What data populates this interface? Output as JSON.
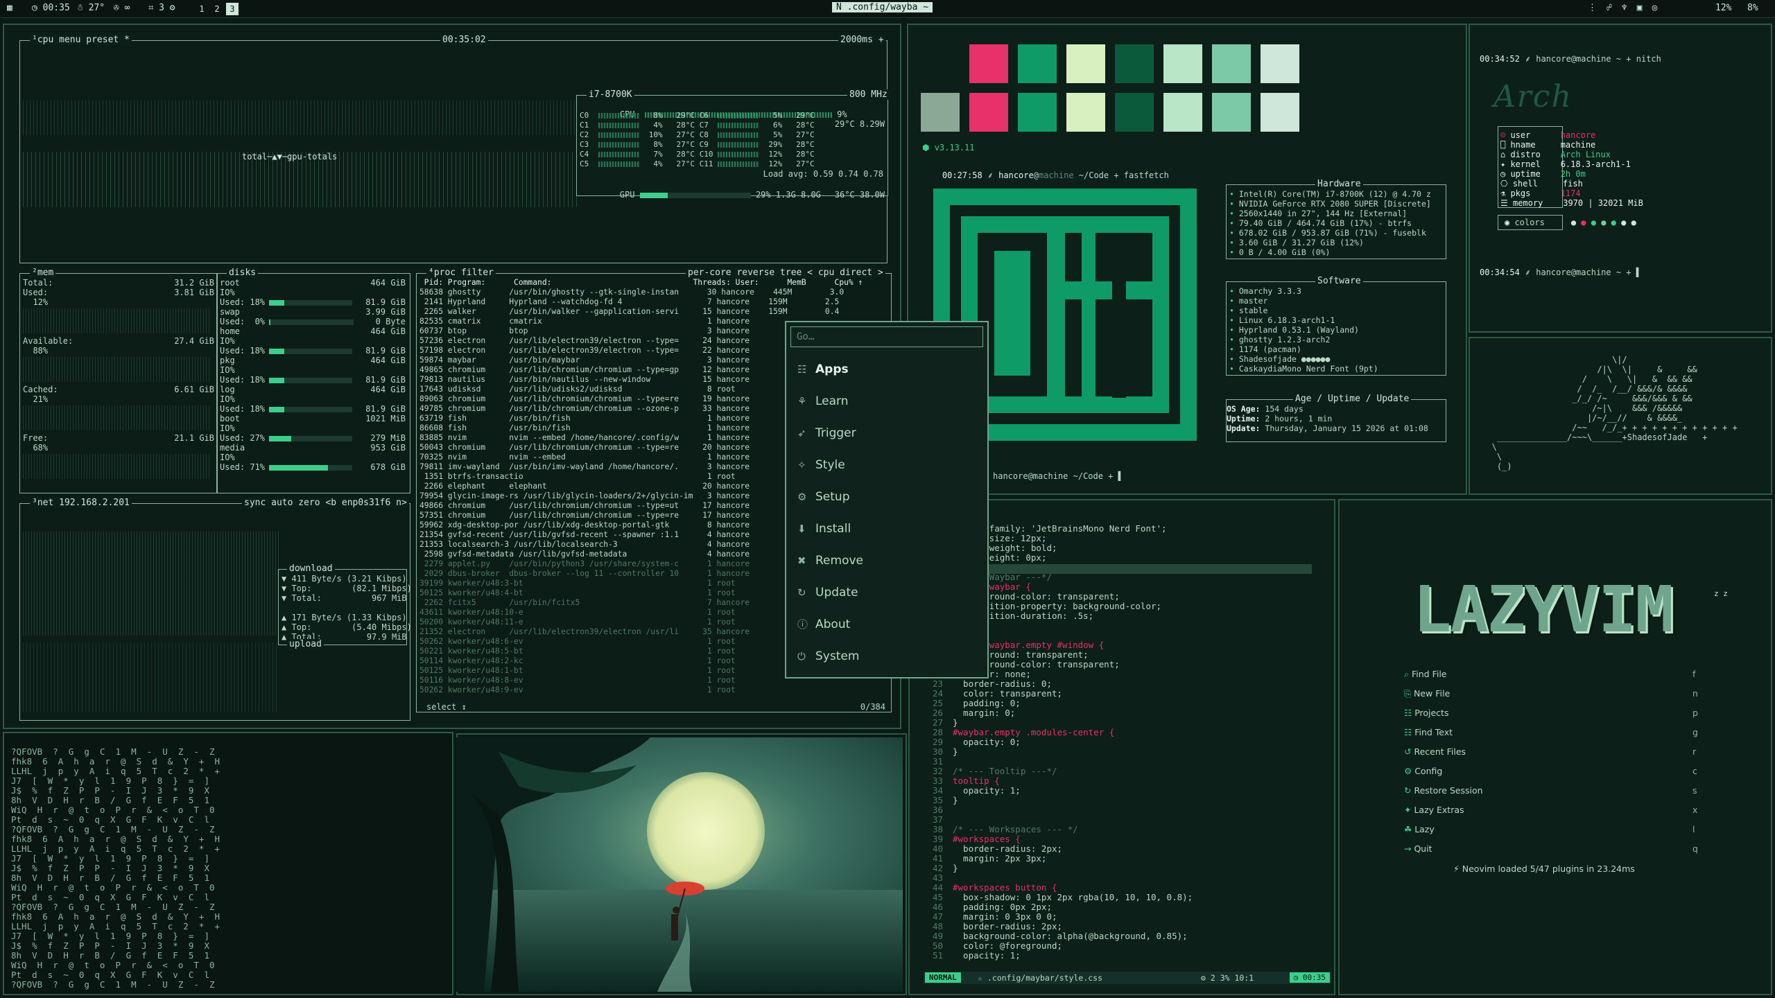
{
  "topbar": {
    "clock": "◷ 00:35",
    "weather": "☃ 27°",
    "indicators": "✇ ∞",
    "icons2": "⌗ 3 ⚙",
    "workspaces": [
      "1",
      "2",
      "3"
    ],
    "title": "N  .config/wayba ~",
    "right_battery": "12%",
    "right_vol": "8%"
  },
  "btop": {
    "cpu_header": "¹cpu menu preset *",
    "cpu_time": "00:35:02",
    "cpu_rate": "2000ms +",
    "total_label": "total─▲▼─gpu-totals",
    "cpu_model": "i7-8700K",
    "cpu_mhz": "800 MHz",
    "cpu_line": "CPU  ",
    "cpu_pct": "9%",
    "cpu_temp": "29°C 8.29W",
    "cores": [
      [
        "C0",
        "8%",
        "29°C",
        "C6",
        "5%",
        "29°C"
      ],
      [
        "C1",
        "4%",
        "28°C",
        "C7",
        "6%",
        "28°C"
      ],
      [
        "C2",
        "10%",
        "27°C",
        "C8",
        "5%",
        "27°C"
      ],
      [
        "C3",
        "8%",
        "27°C",
        "C9",
        "29%",
        "28°C"
      ],
      [
        "C4",
        "7%",
        "28°C",
        "C10",
        "12%",
        "28°C"
      ],
      [
        "C5",
        "4%",
        "27°C",
        "C11",
        "12%",
        "27°C"
      ]
    ],
    "load_avg": "Load avg: 0.59 0.74 0.78",
    "gpu_line": "GPU",
    "gpu_pct": "29%",
    "gpu_mem": "1.3G 8.0G",
    "gpu_temp": "36°C 38.0W",
    "mem_header": "²mem",
    "mem": [
      {
        "k": "Total:",
        "v": "31.2 GiB"
      },
      {
        "k": "Used:",
        "v": "3.81 GiB",
        "p": "12%"
      },
      {
        "k": "Available:",
        "v": "27.4 GiB",
        "p": "88%"
      },
      {
        "k": "Cached:",
        "v": "6.61 GiB",
        "p": "21%"
      },
      {
        "k": "Free:",
        "v": "21.1 GiB",
        "p": "68%"
      }
    ],
    "disks_header": "disks",
    "disks": [
      {
        "name": "root",
        "size": "464 GiB",
        "io": "IO%",
        "used": "Used: 18%",
        "uv": "81.9 GiB"
      },
      {
        "name": "swap",
        "size": "3.99 GiB",
        "io": "",
        "used": "Used:  0%",
        "uv": "0 Byte"
      },
      {
        "name": "home",
        "size": "464 GiB",
        "io": "IO%",
        "used": "Used: 18%",
        "uv": "81.9 GiB"
      },
      {
        "name": "pkg",
        "size": "464 GiB",
        "io": "IO%",
        "used": "Used: 18%",
        "uv": "81.9 GiB"
      },
      {
        "name": "log",
        "size": "464 GiB",
        "io": "IO%",
        "used": "Used: 18%",
        "uv": "81.9 GiB"
      },
      {
        "name": "boot",
        "size": "1021 MiB",
        "io": "IO%",
        "used": "Used: 27%",
        "uv": "279 MiB"
      },
      {
        "name": "media",
        "size": "953 GiB",
        "io": "IO%",
        "used": "Used: 71%",
        "uv": "678 GiB"
      }
    ],
    "net_header": "³net 192.168.2.201",
    "net_opts": "sync auto zero <b enp0s31f6 n>",
    "download_lbl": "download",
    "dl": [
      "▼ 411 Byte/s (3.21 Kibps)",
      "▼ Top:        (82.1 Mibps)",
      "▼ Total:          967 MiB"
    ],
    "ul": [
      "▲ 171 Byte/s (1.33 Kibps)",
      "▲ Top:        (5.40 Mibps)",
      "▲ Total:         97.9 MiB"
    ],
    "upload_lbl": "upload",
    "proc_header": "⁴proc filter",
    "proc_opts": "per-core reverse tree < cpu direct >",
    "proc_cols": " Pid: Program:      Command:                              Threads: User:      MemB      Cpu% ↑",
    "procs": [
      "58638 ghostty      /usr/bin/ghostty --gtk-single-instan      30 hancore    445M        3.0",
      " 2141 Hyprland     Hyprland --watchdog-fd 4                  7 hancore    159M        2.5",
      " 2265 walker       /usr/bin/walker --gapplication-servi     15 hancore    159M        0.4",
      "82535 cmatrix      cmatrix                                   1 hancore",
      "60737 btop         btop                                      3 hancore",
      "57236 electron     /usr/lib/electron39/electron --type=     24 hancore",
      "57198 electron     /usr/lib/electron39/electron --type=     22 hancore",
      "59874 maybar       /usr/bin/maybar                           3 hancore",
      "49865 chromium     /usr/lib/chromium/chromium --type=gp     12 hancore",
      "79813 nautilus     /usr/bin/nautilus --new-window           15 hancore",
      "17643 udisksd      /usr/lib/udisks2/udisksd                  8 root",
      "89063 chromium     /usr/lib/chromium/chromium --type=re     19 hancore",
      "49785 chromium     /usr/lib/chromium/chromium --ozone-p     33 hancore",
      "63719 fish         /usr/bin/fish                             1 hancore",
      "86608 fish         /usr/bin/fish                             1 hancore",
      "83885 nvim         nvim --embed /home/hancore/.config/w      1 hancore",
      "50043 chromium     /usr/lib/chromium/chromium --type=re     20 hancore",
      "70325 nvim         nvim --embed                              1 hancore",
      "79811 imv-wayland  /usr/bin/imv-wayland /home/hancore/.      3 hancore",
      " 1351 btrfs-transactio                                       1 root",
      " 2266 elephant     elephant                                 20 hancore",
      "79954 glycin-image-rs /usr/lib/glycin-loaders/2+/glycin-im   3 hancore",
      "49866 chromium     /usr/lib/chromium/chromium --type=ut     17 hancore",
      "57351 chromium     /usr/lib/chromium/chromium --type=re     17 hancore",
      "59962 xdg-desktop-por /usr/lib/xdg-desktop-portal-gtk        8 hancore",
      "21354 gvfsd-recent /usr/lib/gvfsd-recent --spawner :1.1      4 hancore",
      "21353 localsearch-3 /usr/lib/localsearch-3                   4 hancore",
      " 2598 gvfsd-metadata /usr/lib/gvfsd-metadata                 4 hancore",
      " 2279 applet.py    /usr/bin/python3 /usr/share/system-c      1 hancore",
      " 2029 dbus-broker  dbus-broker --log 11 --controller 10      1 hancore",
      "39199 kworker/u48:3-bt                                       1 root",
      "50125 kworker/u48:4-bt                                       1 root",
      " 2262 fcitx5       /usr/bin/fcitx5                           7 hancore",
      "43611 kworker/u48:10-e                                       1 root",
      "50200 kworker/u48:11-e                                       1 root",
      "21352 electron     /usr/lib/electron39/electron /usr/li     35 hancore",
      "50262 kworker/u48:6-ev                                       1 root",
      "50221 kworker/u48:5-bt                                       1 root",
      "50114 kworker/u48:2-kc                                       1 root",
      "50125 kworker/u48:1-bt                                       1 root",
      "50116 kworker/u48:8-ev                                       1 root",
      "50262 kworker/u48:9-ev                                       1 root"
    ],
    "proc_footer": "select ↕",
    "proc_count": "0/384"
  },
  "launcher": {
    "placeholder": "Go…",
    "items": [
      {
        "icon": "☷",
        "label": "Apps"
      },
      {
        "icon": "⚘",
        "label": "Learn"
      },
      {
        "icon": "➶",
        "label": "Trigger"
      },
      {
        "icon": "✧",
        "label": "Style"
      },
      {
        "icon": "⚙",
        "label": "Setup"
      },
      {
        "icon": "⬇",
        "label": "Install"
      },
      {
        "icon": "✖",
        "label": "Remove"
      },
      {
        "icon": "↻",
        "label": "Update"
      },
      {
        "icon": "ⓘ",
        "label": "About"
      },
      {
        "icon": "⏻",
        "label": "System"
      }
    ]
  },
  "fastfetch": {
    "version": "⬢ v3.13.11",
    "prompt_time": "00:27:58",
    "prompt_user": "hancore",
    "prompt_host": "machine",
    "prompt_cmd": "~/Code + fastfetch",
    "hardware_title": "Hardware",
    "hardware": [
      "Intel(R) Core(TM) i7-8700K (12) @ 4.70 z",
      "NVIDIA GeForce RTX 2080 SUPER [Discrete]",
      "2560x1440 in 27\", 144 Hz [External]",
      "79.40 GiB / 464.74 GiB (17%) - btrfs",
      "678.02 GiB / 953.87 GiB (71%) - fuseblk",
      "3.60 GiB / 31.27 GiB (12%)",
      "0 B / 4.00 GiB (0%)"
    ],
    "software_title": "Software",
    "software": [
      "Omarchy 3.3.3",
      "master",
      "stable",
      "Linux 6.18.3-arch1-1",
      "Hyprland 0.53.1 (Wayland)",
      "ghostty 1.2.3-arch2",
      "1174 (pacman)",
      "Shadesofjade ●●●●●●",
      "CaskaydiaMono Nerd Font (9pt)"
    ],
    "age_title": "Age / Uptime / Update",
    "age": [
      {
        "k": "OS Age:",
        "v": "154 days"
      },
      {
        "k": "Uptime:",
        "v": "2 hours, 1 min"
      },
      {
        "k": "Update:",
        "v": "Thursday, January 15 2026 at 01:08"
      }
    ],
    "prompt2": "hancore@machine ~/Code + ▌",
    "colors": {
      "pink": "#e8306a",
      "green": "#0f9b67",
      "lime": "#d8f0c0",
      "dark": "#0b5a3b",
      "mint": "#b9e6c6",
      "seafoam": "#7cc9a8",
      "pale": "#cfe6da",
      "gray": "#8aa894"
    }
  },
  "nitch": {
    "prompt1_time": "00:34:52",
    "prompt1": "⸙ hancore@machine ~ + nitch",
    "logo": "Arch",
    "rows": [
      {
        "k": "user",
        "v": "hancore"
      },
      {
        "k": "hname",
        "v": "machine"
      },
      {
        "k": "distro",
        "v": "Arch Linux"
      },
      {
        "k": "kernel",
        "v": "6.18.3-arch1-1"
      },
      {
        "k": "uptime",
        "v": "2h 0m"
      },
      {
        "k": "shell",
        "v": "fish"
      },
      {
        "k": "pkgs",
        "v": "1174"
      },
      {
        "k": "memory",
        "v": "3970 | 32021 MiB"
      }
    ],
    "colors_label": "colors",
    "prompt2_time": "00:34:54",
    "prompt2": "⸙ hancore@machine ~ + ▌"
  },
  "ascii_art": {
    "lines": [
      "                           \\|/",
      "                        /|\\  \\|     &     &&",
      "                     /    \\   \\|   &  && &&",
      "                    /  /_  /__/ &&&/& &&&&",
      "                   _/_/ /~     &&&/&&& & &&",
      "                       /~|\\    &&& /&&&&&",
      "                      |/~/__//    & &&&&_",
      "                   /~~   /_/_+ + + + + + + + + + + +",
      "    ______________/~~~\\______+ShadesofJade   +",
      "   \\",
      "    \\",
      "    (_)"
    ],
    "signature": "ShadesofJade"
  },
  "nvim": {
    "code": [
      {
        "n": "",
        "t": "  font-family: 'JetBrainsMono Nerd Font';"
      },
      {
        "n": "",
        "t": "  font-size: 12px;"
      },
      {
        "n": "",
        "t": "  font-weight: bold;"
      },
      {
        "n": "",
        "t": "  min-height: 0px;"
      },
      {
        "n": "",
        "t": ""
      },
      {
        "n": "",
        "t": "/* --- Waybar ---*/"
      },
      {
        "n": "",
        "t": "window#waybar {"
      },
      {
        "n": "",
        "t": "  background-color: transparent;"
      },
      {
        "n": "",
        "t": "  transition-property: background-color;"
      },
      {
        "n": "",
        "t": "  transition-duration: .5s;"
      },
      {
        "n": "",
        "t": "}"
      },
      {
        "n": "",
        "t": ""
      },
      {
        "n": "",
        "t": "window#waybar.empty #window {"
      },
      {
        "n": "",
        "t": "  background: transparent;"
      },
      {
        "n": "",
        "t": "  background-color: transparent;"
      },
      {
        "n": "22",
        "t": "  border: none;"
      },
      {
        "n": "23",
        "t": "  border-radius: 0;"
      },
      {
        "n": "24",
        "t": "  color: transparent;"
      },
      {
        "n": "25",
        "t": "  padding: 0;"
      },
      {
        "n": "26",
        "t": "  margin: 0;"
      },
      {
        "n": "27",
        "t": "}"
      },
      {
        "n": "28",
        "t": "#waybar.empty .modules-center {"
      },
      {
        "n": "29",
        "t": "  opacity: 0;"
      },
      {
        "n": "30",
        "t": "}"
      },
      {
        "n": "31",
        "t": ""
      },
      {
        "n": "32",
        "t": "/* --- Tooltip ---*/"
      },
      {
        "n": "33",
        "t": "tooltip {"
      },
      {
        "n": "34",
        "t": "  opacity: 1;"
      },
      {
        "n": "35",
        "t": "}"
      },
      {
        "n": "36",
        "t": ""
      },
      {
        "n": "37",
        "t": ""
      },
      {
        "n": "38",
        "t": "/* --- Workspaces --- */"
      },
      {
        "n": "39",
        "t": "#workspaces {"
      },
      {
        "n": "40",
        "t": "  border-radius: 2px;"
      },
      {
        "n": "41",
        "t": "  margin: 2px 3px;"
      },
      {
        "n": "42",
        "t": "}"
      },
      {
        "n": "43",
        "t": ""
      },
      {
        "n": "44",
        "t": "#workspaces button {"
      },
      {
        "n": "45",
        "t": "  box-shadow: 0 1px 2px rgba(10, 10, 10, 0.8);"
      },
      {
        "n": "46",
        "t": "  padding: 0px 2px;"
      },
      {
        "n": "47",
        "t": "  margin: 0 3px 0 0;"
      },
      {
        "n": "48",
        "t": "  border-radius: 2px;"
      },
      {
        "n": "49",
        "t": "  background-color: alpha(@background, 0.85);"
      },
      {
        "n": "50",
        "t": "  color: @foreground;"
      },
      {
        "n": "51",
        "t": "  opacity: 1;"
      }
    ],
    "mode": "NORMAL",
    "file": "☆ .config/maybar/style.css",
    "status_right": "⚙ 2   3%   10:1",
    "clock": "◷ 00:35"
  },
  "lazyvim": {
    "logo": "LAZYVIM",
    "zz": "z z",
    "items": [
      {
        "icon": "⌕",
        "label": "Find File",
        "key": "f"
      },
      {
        "icon": "⎘",
        "label": "New File",
        "key": "n"
      },
      {
        "icon": "☷",
        "label": "Projects",
        "key": "p"
      },
      {
        "icon": "☷",
        "label": "Find Text",
        "key": "g"
      },
      {
        "icon": "↺",
        "label": "Recent Files",
        "key": "r"
      },
      {
        "icon": "⚙",
        "label": "Config",
        "key": "c"
      },
      {
        "icon": "↻",
        "label": "Restore Session",
        "key": "s"
      },
      {
        "icon": "✦",
        "label": "Lazy Extras",
        "key": "x"
      },
      {
        "icon": "☘",
        "label": "Lazy",
        "key": "l"
      },
      {
        "icon": "→",
        "label": "Quit",
        "key": "q"
      }
    ],
    "footer": "⚡ Neovim loaded 5/47 plugins in 23.24ms"
  },
  "matrix": {
    "cols": [
      "?QFOVB  ?  G  g  C  1  M  -  U  Z  -  Z",
      "fhk8  6  A  h  a  r  @  S  d  &  Y  +  H",
      "LLHL  j  p  y  A  i  q  5  T  c  2  *  +",
      "J7  [  W  *  y  l  1  9  P  8  }  =  ]",
      "J$  %  f  Z  P  P  -  I  J  3  *  9  X",
      "8h  V  D  H  r  B  /  G  f  E  F  5  1",
      "WiQ  H  r  @  t  o  P  r  &  <  o  T  0",
      "Pt  d  s  ~  0  q  X  G  F  K  v  C  l"
    ]
  }
}
